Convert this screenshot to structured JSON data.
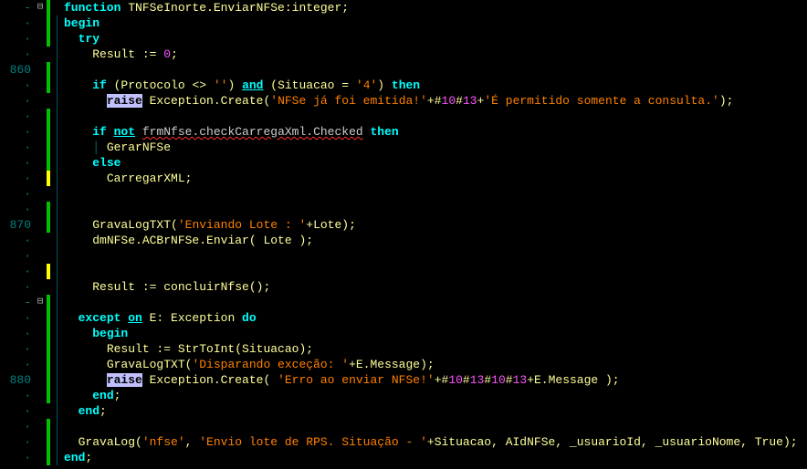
{
  "line_numbers": [
    "-",
    "·",
    "·",
    "·",
    "860",
    "·",
    "·",
    "·",
    "·",
    "·",
    "·",
    "·",
    "·",
    "·",
    "870",
    "·",
    "·",
    "·",
    "·",
    "-",
    "·",
    "·",
    "·",
    "·",
    "880",
    "·",
    "·",
    "·",
    "·",
    "·"
  ],
  "fold_marks": [
    "⊟",
    "",
    "",
    "",
    "",
    "",
    "",
    "",
    "",
    "",
    "",
    "",
    "",
    "",
    "",
    "",
    "",
    "",
    "",
    "⊟",
    "",
    "",
    "",
    "",
    "",
    "",
    "",
    "",
    "",
    ""
  ],
  "change_marks": [
    "green",
    "green",
    "green",
    "",
    "green",
    "green",
    "",
    "green",
    "green",
    "green",
    "green",
    "yellow",
    "",
    "green",
    "green",
    "",
    "",
    "yellow",
    "",
    "green",
    "green",
    "green",
    "green",
    "green",
    "green",
    "green",
    "",
    "green",
    "green",
    "green"
  ],
  "guides": [
    "",
    "v",
    "v",
    "v",
    "v",
    "v",
    "v",
    "v",
    "v",
    "v",
    "v",
    "v",
    "v",
    "v",
    "v",
    "v",
    "v",
    "v",
    "v",
    "v",
    "v",
    "v",
    "v",
    "v",
    "v",
    "v",
    "v",
    "v",
    "v",
    "v"
  ],
  "code": {
    "l0": {
      "indent": "",
      "tokens": [
        {
          "c": "kw",
          "t": "function "
        },
        {
          "c": "txt",
          "t": "TNFSeInorte.EnviarNFSe:integer;"
        }
      ]
    },
    "l1": {
      "indent": "",
      "tokens": [
        {
          "c": "kw",
          "t": "begin"
        }
      ]
    },
    "l2": {
      "indent": "  ",
      "tokens": [
        {
          "c": "kw",
          "t": "try"
        }
      ]
    },
    "l3": {
      "indent": "    ",
      "tokens": [
        {
          "c": "txt",
          "t": "Result := "
        },
        {
          "c": "num",
          "t": "0"
        },
        {
          "c": "txt",
          "t": ";"
        }
      ]
    },
    "l4": {
      "indent": "",
      "tokens": [
        {
          "c": "txt",
          "t": ""
        }
      ]
    },
    "l5": {
      "indent": "    ",
      "tokens": [
        {
          "c": "kw",
          "t": "if "
        },
        {
          "c": "txt",
          "t": "(Protocolo <> "
        },
        {
          "c": "str",
          "t": "''"
        },
        {
          "c": "txt",
          "t": ") "
        },
        {
          "c": "kwu",
          "t": "and"
        },
        {
          "c": "txt",
          "t": " (Situacao = "
        },
        {
          "c": "str",
          "t": "'4'"
        },
        {
          "c": "txt",
          "t": ") "
        },
        {
          "c": "kw",
          "t": "then"
        }
      ]
    },
    "l6": {
      "indent": "      ",
      "tokens": [
        {
          "c": "hl",
          "t": "raise"
        },
        {
          "c": "txt",
          "t": " Exception.Create("
        },
        {
          "c": "str",
          "t": "'NFSe já foi emitida!'"
        },
        {
          "c": "txt",
          "t": "+#"
        },
        {
          "c": "num",
          "t": "10"
        },
        {
          "c": "txt",
          "t": "#"
        },
        {
          "c": "num",
          "t": "13"
        },
        {
          "c": "txt",
          "t": "+"
        },
        {
          "c": "str",
          "t": "'É permitido somente a consulta.'"
        },
        {
          "c": "txt",
          "t": ");"
        }
      ]
    },
    "l7": {
      "indent": "",
      "tokens": [
        {
          "c": "txt",
          "t": ""
        }
      ]
    },
    "l8": {
      "indent": "    ",
      "tokens": [
        {
          "c": "kw",
          "t": "if "
        },
        {
          "c": "kwu",
          "t": "not"
        },
        {
          "c": "txt",
          "t": " "
        },
        {
          "c": "errline",
          "t": "frmNfse.checkCarregaXml.Checked"
        },
        {
          "c": "txt",
          "t": " "
        },
        {
          "c": "kw",
          "t": "then"
        }
      ]
    },
    "l9": {
      "indent": "    ",
      "tokens": [
        {
          "c": "guide",
          "t": "│ "
        },
        {
          "c": "txt",
          "t": "GerarNFSe"
        }
      ]
    },
    "l10": {
      "indent": "    ",
      "tokens": [
        {
          "c": "kw",
          "t": "else"
        }
      ]
    },
    "l11": {
      "indent": "      ",
      "tokens": [
        {
          "c": "txt",
          "t": "CarregarXML;"
        }
      ]
    },
    "l12": {
      "indent": "",
      "tokens": [
        {
          "c": "txt",
          "t": ""
        }
      ]
    },
    "l13": {
      "indent": "",
      "tokens": [
        {
          "c": "txt",
          "t": ""
        }
      ]
    },
    "l14": {
      "indent": "    ",
      "tokens": [
        {
          "c": "txt",
          "t": "GravaLogTXT("
        },
        {
          "c": "str",
          "t": "'Enviando Lote : '"
        },
        {
          "c": "txt",
          "t": "+Lote);"
        }
      ]
    },
    "l15": {
      "indent": "    ",
      "tokens": [
        {
          "c": "txt",
          "t": "dmNFSe.ACBrNFSe.Enviar( Lote );"
        }
      ]
    },
    "l16": {
      "indent": "",
      "tokens": [
        {
          "c": "txt",
          "t": ""
        }
      ]
    },
    "l17": {
      "indent": "",
      "tokens": [
        {
          "c": "txt",
          "t": ""
        }
      ]
    },
    "l18": {
      "indent": "    ",
      "tokens": [
        {
          "c": "txt",
          "t": "Result := concluirNfse();"
        }
      ]
    },
    "l19": {
      "indent": "",
      "tokens": [
        {
          "c": "txt",
          "t": ""
        }
      ]
    },
    "l20": {
      "indent": "  ",
      "tokens": [
        {
          "c": "kw",
          "t": "except "
        },
        {
          "c": "kwu",
          "t": "on"
        },
        {
          "c": "txt",
          "t": " E: Exception "
        },
        {
          "c": "kw",
          "t": "do"
        }
      ]
    },
    "l21": {
      "indent": "    ",
      "tokens": [
        {
          "c": "kw",
          "t": "begin"
        }
      ]
    },
    "l22": {
      "indent": "      ",
      "tokens": [
        {
          "c": "txt",
          "t": "Result := StrToInt(Situacao);"
        }
      ]
    },
    "l23": {
      "indent": "      ",
      "tokens": [
        {
          "c": "txt",
          "t": "GravaLogTXT("
        },
        {
          "c": "str",
          "t": "'Disparando exceção: '"
        },
        {
          "c": "txt",
          "t": "+E.Message);"
        }
      ]
    },
    "l24": {
      "indent": "      ",
      "tokens": [
        {
          "c": "hl",
          "t": "raise"
        },
        {
          "c": "txt",
          "t": " Exception.Create( "
        },
        {
          "c": "str",
          "t": "'Erro ao enviar NFSe!'"
        },
        {
          "c": "txt",
          "t": "+#"
        },
        {
          "c": "num",
          "t": "10"
        },
        {
          "c": "txt",
          "t": "#"
        },
        {
          "c": "num",
          "t": "13"
        },
        {
          "c": "txt",
          "t": "#"
        },
        {
          "c": "num",
          "t": "10"
        },
        {
          "c": "txt",
          "t": "#"
        },
        {
          "c": "num",
          "t": "13"
        },
        {
          "c": "txt",
          "t": "+E.Message );"
        }
      ]
    },
    "l25": {
      "indent": "    ",
      "tokens": [
        {
          "c": "kw",
          "t": "end"
        },
        {
          "c": "txt",
          "t": ";"
        }
      ]
    },
    "l26": {
      "indent": "  ",
      "tokens": [
        {
          "c": "kw",
          "t": "end"
        },
        {
          "c": "txt",
          "t": ";"
        }
      ]
    },
    "l27": {
      "indent": "",
      "tokens": [
        {
          "c": "txt",
          "t": ""
        }
      ]
    },
    "l28": {
      "indent": "  ",
      "tokens": [
        {
          "c": "txt",
          "t": "GravaLog("
        },
        {
          "c": "str",
          "t": "'nfse'"
        },
        {
          "c": "txt",
          "t": ", "
        },
        {
          "c": "str",
          "t": "'Envio lote de RPS. Situação - '"
        },
        {
          "c": "txt",
          "t": "+Situacao, AIdNFSe, _usuarioId, _usuarioNome, True);"
        }
      ]
    },
    "l29": {
      "indent": "",
      "tokens": [
        {
          "c": "kw",
          "t": "end"
        },
        {
          "c": "txt",
          "t": ";"
        }
      ]
    }
  }
}
